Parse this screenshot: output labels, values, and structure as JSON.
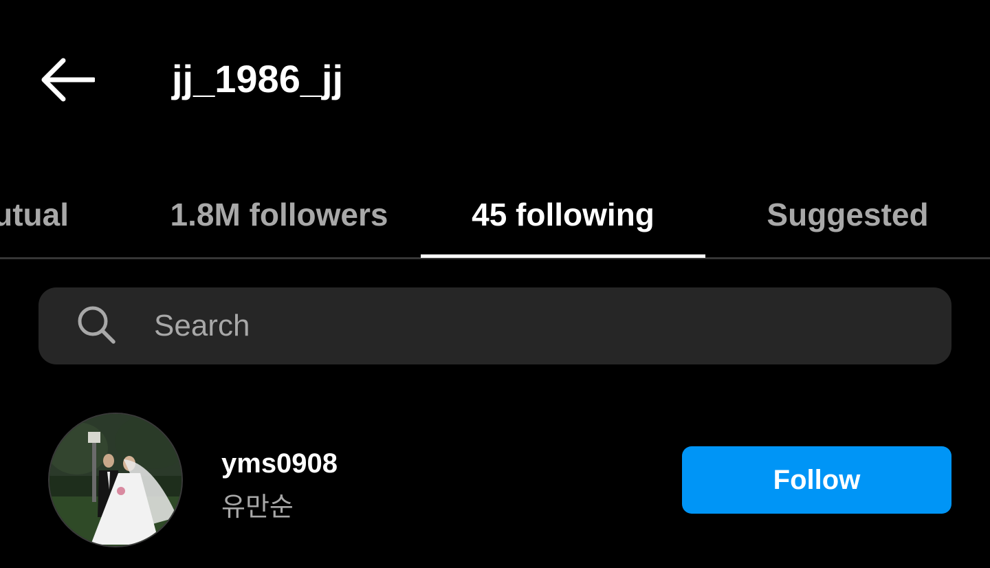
{
  "header": {
    "title": "jj_1986_jj",
    "back_icon": "arrow-left-icon"
  },
  "tabs": [
    {
      "label": "mutual",
      "active": false
    },
    {
      "label": "1.8M followers",
      "active": false
    },
    {
      "label": "45 following",
      "active": true
    },
    {
      "label": "Suggested",
      "active": false
    }
  ],
  "search": {
    "placeholder": "Search",
    "value": "",
    "icon": "search-icon"
  },
  "following_list": [
    {
      "username": "yms0908",
      "full_name": "유만순",
      "avatar": "avatar-photo",
      "action_label": "Follow"
    }
  ],
  "colors": {
    "background": "#000000",
    "primary_text": "#ffffff",
    "secondary_text": "#a8a8a8",
    "search_bg": "#262626",
    "divider": "#363636",
    "follow_button": "#0095f6"
  }
}
